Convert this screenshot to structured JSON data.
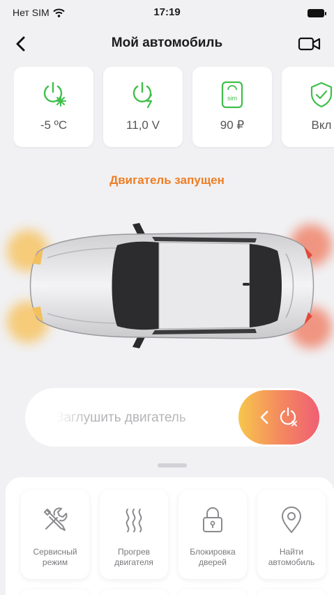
{
  "status_bar": {
    "carrier": "Нет SIM",
    "time": "17:19",
    "wifi_icon": "wifi-icon",
    "battery_icon": "battery-icon"
  },
  "nav": {
    "title": "Мой автомобиль",
    "back_icon": "chevron-left-icon",
    "camera_icon": "video-camera-icon"
  },
  "cards": [
    {
      "icon": "power-snowflake-icon",
      "value": "-5 ºC"
    },
    {
      "icon": "power-bolt-icon",
      "value": "11,0 V"
    },
    {
      "icon": "sim-card-icon",
      "value": "90 ₽"
    },
    {
      "icon": "shield-check-icon",
      "value": "Вкл"
    }
  ],
  "engine_status": "Двигатель запущен",
  "slider": {
    "label": "Заглушить двигатель",
    "knob_icons": [
      "chevron-left-icon",
      "power-off-icon"
    ]
  },
  "actions": [
    {
      "icon": "wrench-screwdriver-icon",
      "label": "Сервисный\nрежим"
    },
    {
      "icon": "heat-waves-icon",
      "label": "Прогрев\nдвигателя"
    },
    {
      "icon": "padlock-icon",
      "label": "Блокировка\nдверей"
    },
    {
      "icon": "map-pin-icon",
      "label": "Найти\nавтомобиль"
    }
  ],
  "colors": {
    "accent_orange": "#ef7d23",
    "green": "#3fbf4a",
    "background": "#f1f1f3"
  }
}
